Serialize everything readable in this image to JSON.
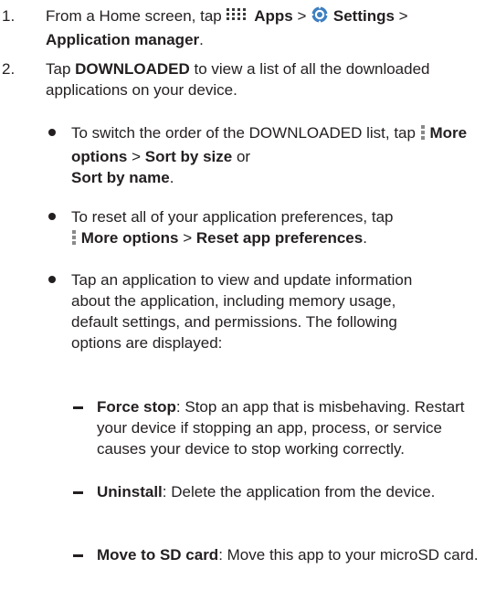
{
  "step1": {
    "num": "1.",
    "lead": "From a Home screen, tap",
    "apps": "Apps",
    "gt1": ">",
    "settings": "Settings",
    "gt2": ">",
    "appmgr": "Application manager",
    "end": "."
  },
  "step2": {
    "num": "2.",
    "tap": "Tap",
    "downloaded": "DOWNLOADED",
    "rest": "to view a list of all the downloaded applications on your device."
  },
  "bullet1": {
    "lead": "To switch the order of the DOWNLOADED list, tap",
    "more": "More options",
    "gt": ">",
    "size": "Sort by size",
    "or": "or",
    "name": "Sort by name",
    "end": "."
  },
  "bullet2": {
    "lead": "To reset all of your application preferences, tap",
    "more": "More options",
    "gt": ">",
    "reset": "Reset app preferences",
    "end": "."
  },
  "bullet3": {
    "text": "Tap an application to view and update information about the application, including memory usage, default settings, and permissions. The following options are displayed:"
  },
  "dash1": {
    "term": "Force stop",
    "desc": ": Stop an app that is misbehaving. Restart your device if stopping an app, process, or service causes your device to stop working correctly."
  },
  "dash2": {
    "term": "Uninstall",
    "desc": ": Delete the application from the device."
  },
  "dash3": {
    "term": "Move to SD card",
    "desc": ": Move this app to your microSD card."
  },
  "icons": {
    "apps": "apps-grid-icon",
    "settings": "settings-gear-icon",
    "more": "more-options-icon"
  }
}
